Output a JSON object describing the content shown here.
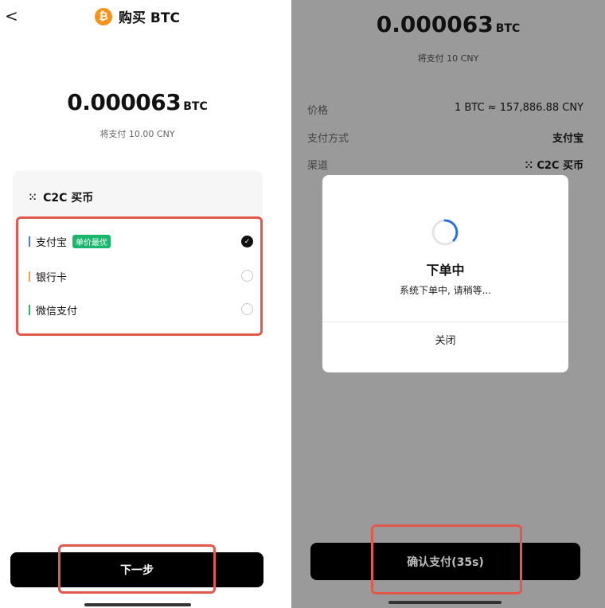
{
  "left": {
    "header": {
      "back": "<",
      "coin_glyph": "₿",
      "title": "购买 BTC"
    },
    "amount": {
      "value": "0.000063",
      "unit": "BTC"
    },
    "pay_note": "将支付 10.00 CNY",
    "card": {
      "title": "C2C 买币",
      "methods": [
        {
          "label": "支付宝",
          "tag": "单价最优",
          "selected": true,
          "bar_color": "#4a77d4"
        },
        {
          "label": "银行卡",
          "selected": false,
          "bar_color": "#f0a54a"
        },
        {
          "label": "微信支付",
          "selected": false,
          "bar_color": "#2fb36a"
        }
      ]
    },
    "next_label": "下一步"
  },
  "right": {
    "amount": {
      "value": "0.000063",
      "unit": "BTC"
    },
    "pay_note": "将支付 10 CNY",
    "rows": [
      {
        "label": "价格",
        "value": "1 BTC ≈ 157,886.88 CNY"
      },
      {
        "label": "支付方式",
        "value": "支付宝"
      },
      {
        "label": "渠道",
        "value": "C2C 买币"
      }
    ],
    "dialog": {
      "title": "下单中",
      "message": "系统下单中, 请稍等...",
      "close_label": "关闭"
    },
    "confirm_label": "确认支付(35s)"
  },
  "colors": {
    "highlight": "#e2584d",
    "tag_green": "#19b66e",
    "btc_orange": "#f7931a",
    "spinner_blue": "#2f6fe0"
  }
}
